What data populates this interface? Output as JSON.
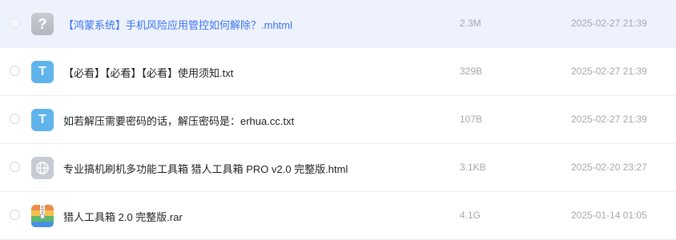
{
  "files": [
    {
      "name": "【鸿蒙系统】手机风险应用管控如何解除？.mhtml",
      "size": "2.3M",
      "date": "2025-02-27 21:39",
      "icon": "unknown-file-icon",
      "icon_glyph": "?",
      "selected": true
    },
    {
      "name": "【必看】【必看】【必看】使用须知.txt",
      "size": "329B",
      "date": "2025-02-27 21:39",
      "icon": "text-file-icon",
      "icon_glyph": "T",
      "selected": false
    },
    {
      "name": "如若解压需要密码的话，解压密码是：erhua.cc.txt",
      "size": "107B",
      "date": "2025-02-27 21:39",
      "icon": "text-file-icon",
      "icon_glyph": "T",
      "selected": false
    },
    {
      "name": "专业搞机刷机多功能工具箱 猎人工具箱 PRO v2.0 完整版.html",
      "size": "3.1KB",
      "date": "2025-02-20 23:27",
      "icon": "globe-icon",
      "selected": false
    },
    {
      "name": "猎人工具箱 2.0 完整版.rar",
      "size": "4.1G",
      "date": "2025-01-14 01:05",
      "icon": "archive-icon",
      "selected": false
    }
  ],
  "colors": {
    "selected_row_bg": "#eef2fd",
    "selected_text": "#3b74f2",
    "txt_icon": "#5fb4ec",
    "meta_text": "#a3a7ae"
  }
}
